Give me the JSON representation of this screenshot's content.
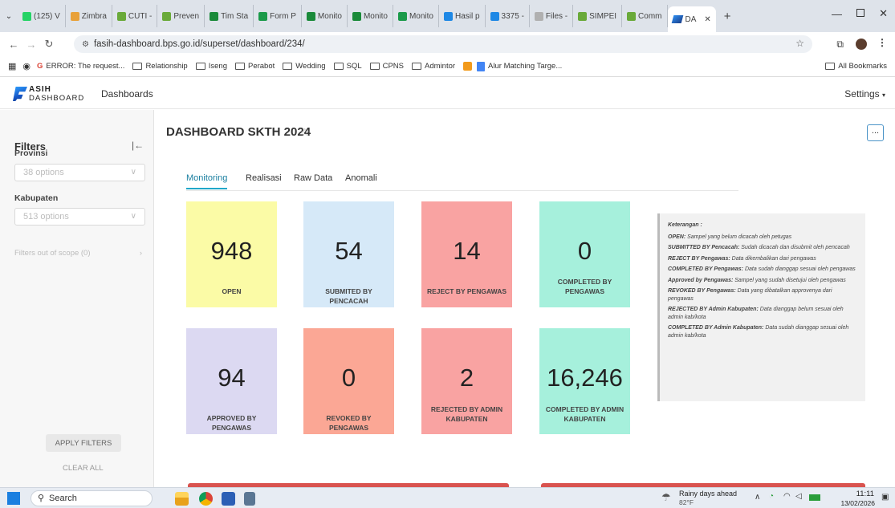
{
  "browser": {
    "tabs": [
      "(125) V",
      "Zimbra",
      "CUTI -",
      "Preven",
      "Tim Sta",
      "Form P",
      "Monito",
      "Monito",
      "Monito",
      "Hasil p",
      "3375 -",
      "Files - ",
      "SIMPEI",
      "Comm"
    ],
    "active_tab": "DA",
    "url": "fasih-dashboard.bps.go.id/superset/dashboard/234/",
    "bookmarks": [
      "ERROR: The request...",
      "Relationship",
      "Iseng",
      "Perabot",
      "Wedding",
      "SQL",
      "CPNS",
      "Admintor",
      "Alur Matching Targe..."
    ],
    "all_bookmarks": "All Bookmarks"
  },
  "header": {
    "logo_top": "ASIH",
    "logo_bottom": "DASHBOARD",
    "nav_dashboards": "Dashboards",
    "settings": "Settings"
  },
  "sidebar": {
    "title": "Filters",
    "provinsi_label": "Provinsi",
    "provinsi_placeholder": "38 options",
    "kabupaten_label": "Kabupaten",
    "kabupaten_placeholder": "513 options",
    "out_of_scope": "Filters out of scope (0)",
    "apply": "APPLY FILTERS",
    "clear": "CLEAR ALL"
  },
  "dashboard": {
    "title": "DASHBOARD SKTH 2024",
    "more": "...",
    "tabs": [
      "Monitoring",
      "Realisasi",
      "Raw Data",
      "Anomali"
    ]
  },
  "cards": [
    {
      "value": "948",
      "label": "OPEN",
      "color": "#fbfba6"
    },
    {
      "value": "54",
      "label": "SUBMITED BY PENCACAH",
      "color": "#d6e9f8"
    },
    {
      "value": "14",
      "label": "REJECT BY PENGAWAS",
      "color": "#f9a3a2"
    },
    {
      "value": "0",
      "label": "COMPLETED BY PENGAWAS",
      "color": "#a6f0dc"
    },
    {
      "value": "94",
      "label": "APPROVED BY PENGAWAS",
      "color": "#dcd9f2"
    },
    {
      "value": "0",
      "label": "REVOKED BY PENGAWAS",
      "color": "#fba795"
    },
    {
      "value": "2",
      "label": "REJECTED BY ADMIN KABUPATEN",
      "color": "#f9a3a2"
    },
    {
      "value": "16,246",
      "label": "COMPLETED BY ADMIN KABUPATEN",
      "color": "#a6f0dc"
    }
  ],
  "legend": {
    "title": "Keterangan :",
    "items": [
      {
        "key": "OPEN:",
        "text": "Sampel yang belum dicacah oleh petugas"
      },
      {
        "key": "SUBMITTED BY Pencacah:",
        "text": "Sudah dicacah dan disubmit oleh pencacah"
      },
      {
        "key": "REJECT BY Pengawas:",
        "text": "Data dikembalikan dari pengawas"
      },
      {
        "key": "COMPLETED BY Pengawas:",
        "text": "Data sudah dianggap sesuai oleh pengawas"
      },
      {
        "key": "Approved by Pengawas:",
        "text": "Sampel yang sudah disetujui oleh pengawas"
      },
      {
        "key": "REVOKED BY Pengawas:",
        "text": "Data yang dibatalkan approvenya dari pengawas"
      },
      {
        "key": "REJECTED BY Admin Kabupaten:",
        "text": "Data dianggap belum sesuai oleh admin kab/kota"
      },
      {
        "key": "COMPLETED BY Admin Kabupaten:",
        "text": "Data sudah dianggap sesuai oleh admin kab/kota"
      }
    ]
  },
  "taskbar": {
    "search": "Search",
    "weather_title": "Rainy days ahead",
    "weather_temp": "82°F",
    "time": "11:11",
    "date": "13/02/2026"
  }
}
